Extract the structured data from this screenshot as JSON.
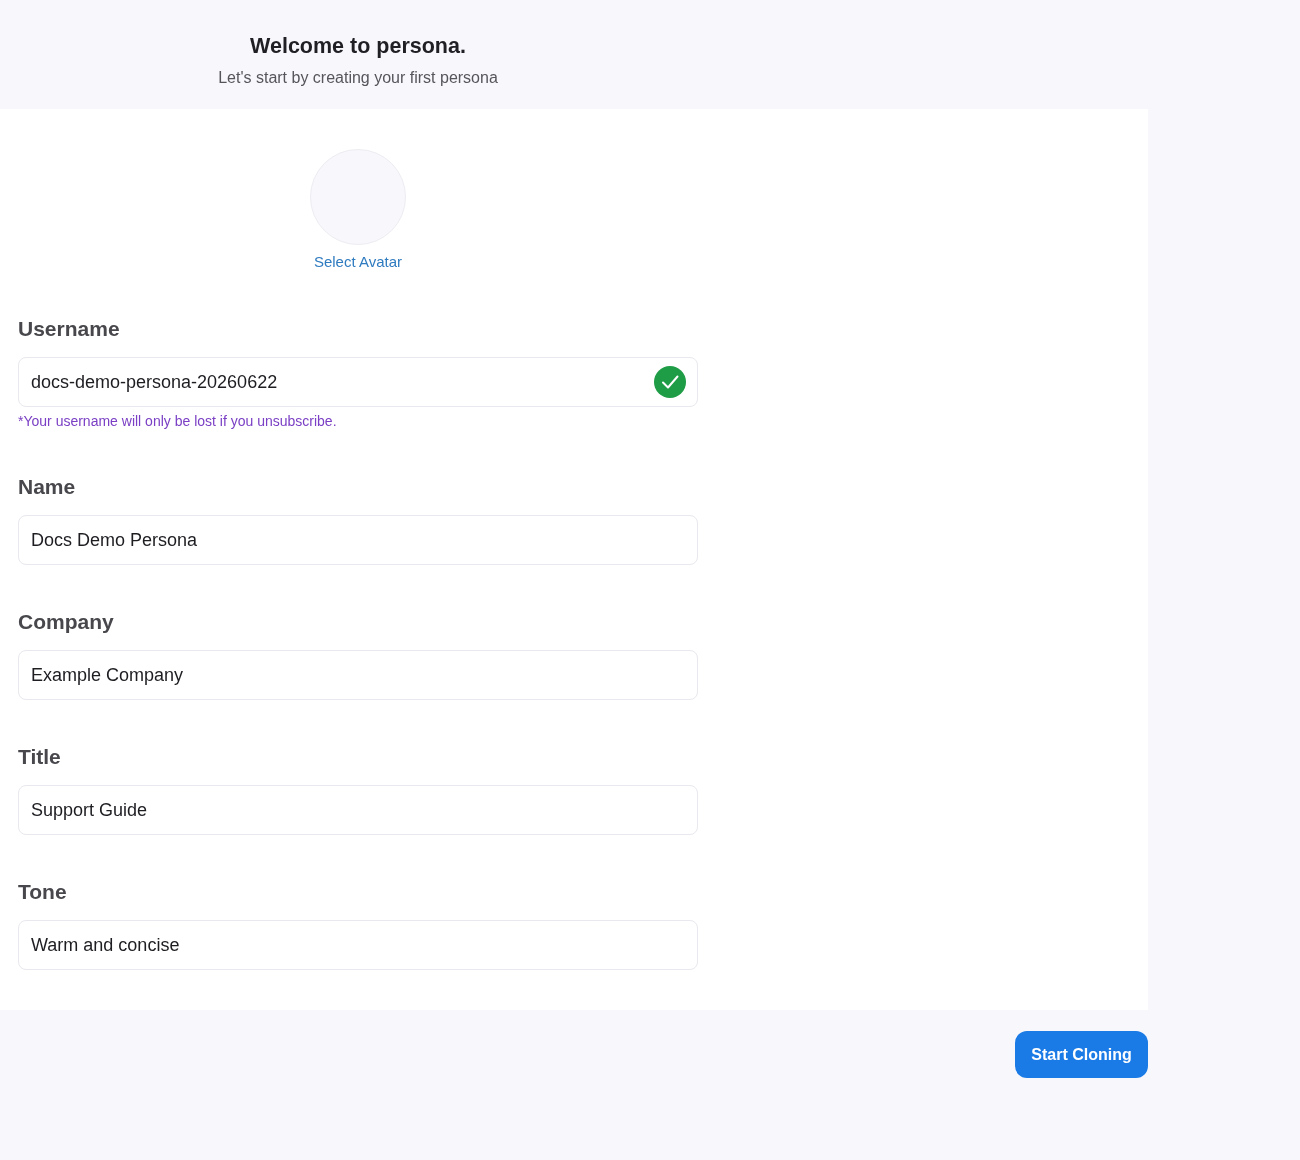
{
  "header": {
    "title": "Welcome to persona.",
    "subtitle": "Let's start by creating your first persona"
  },
  "avatar": {
    "label": "Select Avatar"
  },
  "fields": [
    {
      "label": "Username",
      "value": "docs-demo-persona-20260622",
      "valid": true,
      "note": "*Your username will only be lost if you unsubscribe."
    },
    {
      "label": "Name",
      "value": "Docs Demo Persona",
      "valid": false
    },
    {
      "label": "Company",
      "value": "Example Company",
      "valid": false
    },
    {
      "label": "Title",
      "value": "Support Guide",
      "valid": false
    },
    {
      "label": "Tone",
      "value": "Warm and concise",
      "valid": false
    }
  ],
  "submit": {
    "label": "Start Cloning"
  }
}
